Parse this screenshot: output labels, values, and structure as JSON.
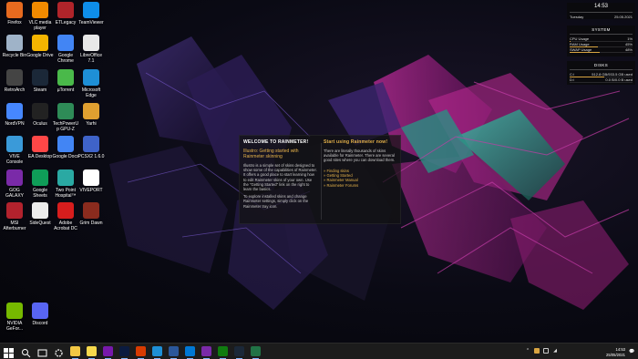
{
  "desktop_icons": [
    {
      "label": "Firefox",
      "icon": "firefox-icon",
      "color": "#e66a1f"
    },
    {
      "label": "VLC media player",
      "icon": "vlc-icon",
      "color": "#f08a00"
    },
    {
      "label": "ETLegacy",
      "icon": "etlegacy-icon",
      "color": "#b0242a"
    },
    {
      "label": "TeamViewer",
      "icon": "teamviewer-icon",
      "color": "#0e8ee9"
    },
    {
      "label": "Recycle Bin",
      "icon": "recycle-bin-icon",
      "color": "#9fb3c8"
    },
    {
      "label": "Google Drive",
      "icon": "google-drive-icon",
      "color": "#f4b400"
    },
    {
      "label": "Google Chrome",
      "icon": "chrome-icon",
      "color": "#4285f4"
    },
    {
      "label": "LibreOffice 7.1",
      "icon": "libreoffice-icon",
      "color": "#e8e8e8"
    },
    {
      "label": "RetroArch",
      "icon": "retroarch-icon",
      "color": "#444444"
    },
    {
      "label": "Steam",
      "icon": "steam-icon",
      "color": "#1b2838"
    },
    {
      "label": "µTorrent",
      "icon": "utorrent-icon",
      "color": "#4ab94a"
    },
    {
      "label": "Microsoft Edge",
      "icon": "edge-icon",
      "color": "#1e8fd6"
    },
    {
      "label": "NordVPN",
      "icon": "nordvpn-icon",
      "color": "#4687ff"
    },
    {
      "label": "Oculus",
      "icon": "oculus-icon",
      "color": "#222222"
    },
    {
      "label": "TechPowerUp GPU-Z",
      "icon": "gpuz-icon",
      "color": "#2e8b57"
    },
    {
      "label": "Yarhi",
      "icon": "yarhi-icon",
      "color": "#e0a030"
    },
    {
      "label": "VIVE Console",
      "icon": "vive-console-icon",
      "color": "#3a9ad9"
    },
    {
      "label": "EA Desktop",
      "icon": "ea-icon",
      "color": "#ff4747"
    },
    {
      "label": "Google Docs",
      "icon": "google-docs-icon",
      "color": "#4285f4"
    },
    {
      "label": "PCSX2 1.6.0",
      "icon": "pcsx2-icon",
      "color": "#3f63c9"
    },
    {
      "label": "GOG GALAXY",
      "icon": "gog-galaxy-icon",
      "color": "#7a2aa8"
    },
    {
      "label": "Google Sheets",
      "icon": "google-sheets-icon",
      "color": "#0f9d58"
    },
    {
      "label": "Two Point Hospital™",
      "icon": "two-point-hospital-icon",
      "color": "#2aa9a3"
    },
    {
      "label": "VIVEPORT",
      "icon": "viveport-icon",
      "color": "#ffffff"
    },
    {
      "label": "MSI Afterburner",
      "icon": "msi-afterburner-icon",
      "color": "#b2222d"
    },
    {
      "label": "SideQuest",
      "icon": "sidequest-icon",
      "color": "#ececec"
    },
    {
      "label": "Adobe Acrobat DC",
      "icon": "acrobat-icon",
      "color": "#d71d1d"
    },
    {
      "label": "Grim Dawn",
      "icon": "grim-dawn-icon",
      "color": "#8a2b1e"
    },
    {
      "label": "NVIDIA GeFor...",
      "icon": "nvidia-icon",
      "color": "#76b900"
    },
    {
      "label": "Discord",
      "icon": "discord-icon",
      "color": "#5865f2"
    }
  ],
  "rainmeter": {
    "left": {
      "title": "WELCOME TO RAINMETER!",
      "subtitle": "Illustro: Getting started with Rainmeter skinning",
      "para1": "Illustro is a simple set of skins designed to show some of the capabilities of Rainmeter. It offers a good place to start learning how to edit Rainmeter skins of your own. Use the \"Getting Started\" link on the right to learn the basics.",
      "para2": "To explore installed skins and change Rainmeter settings, simply click on the Rainmeter tray icon."
    },
    "right": {
      "title": "Start using Rainmeter now!",
      "para1": "There are literally thousands of skins available for Rainmeter. There are several good sites where you can download them.",
      "links": [
        "» Finding skins",
        "» Getting Started",
        "» Rainmeter Manual",
        "» Rainmeter Forums"
      ]
    }
  },
  "clock": {
    "time": "14:53",
    "day": "Tuesday",
    "date": "25.05.2021"
  },
  "system": {
    "title": "SYSTEM",
    "rows": [
      {
        "label": "CPU Usage",
        "value": "1%",
        "fraction": 0.01
      },
      {
        "label": "RAM Usage",
        "value": "45%",
        "fraction": 0.45
      },
      {
        "label": "SWAP Usage",
        "value": "48%",
        "fraction": 0.48
      }
    ]
  },
  "disks": {
    "title": "DISKS",
    "rows": [
      {
        "label": "C:\\",
        "value": "512.8 GB/933.5 GB used",
        "fraction": 0.55
      },
      {
        "label": "D:\\",
        "value": "0.0 B/0.0 B used",
        "fraction": 0.0
      }
    ]
  },
  "taskbar": {
    "apps": [
      {
        "icon": "windows-start-icon",
        "color": "#ffffff"
      },
      {
        "icon": "search-icon",
        "color": "#ffffff"
      },
      {
        "icon": "task-view-icon",
        "color": "#ffffff"
      },
      {
        "icon": "settings-icon",
        "color": "#dddddd"
      },
      {
        "icon": "file-explorer-icon",
        "color": "#f2c744"
      },
      {
        "icon": "sticky-notes-icon",
        "color": "#f7d94c"
      },
      {
        "icon": "onenote-icon",
        "color": "#7719aa"
      },
      {
        "icon": "photoshop-icon",
        "color": "#0b1b3f"
      },
      {
        "icon": "office-icon",
        "color": "#d83b01"
      },
      {
        "icon": "edge-icon",
        "color": "#1e8fd6"
      },
      {
        "icon": "word-icon",
        "color": "#2b579a"
      },
      {
        "icon": "outlook-icon",
        "color": "#0078d4"
      },
      {
        "icon": "gog-galaxy-icon",
        "color": "#7a2aa8"
      },
      {
        "icon": "xbox-icon",
        "color": "#107c10"
      },
      {
        "icon": "steam-icon",
        "color": "#1b2838"
      },
      {
        "icon": "excel-icon",
        "color": "#217346"
      }
    ],
    "tray": {
      "time": "14:53",
      "date": "25/05/2021",
      "chevron": "^",
      "notification": "💬"
    }
  }
}
